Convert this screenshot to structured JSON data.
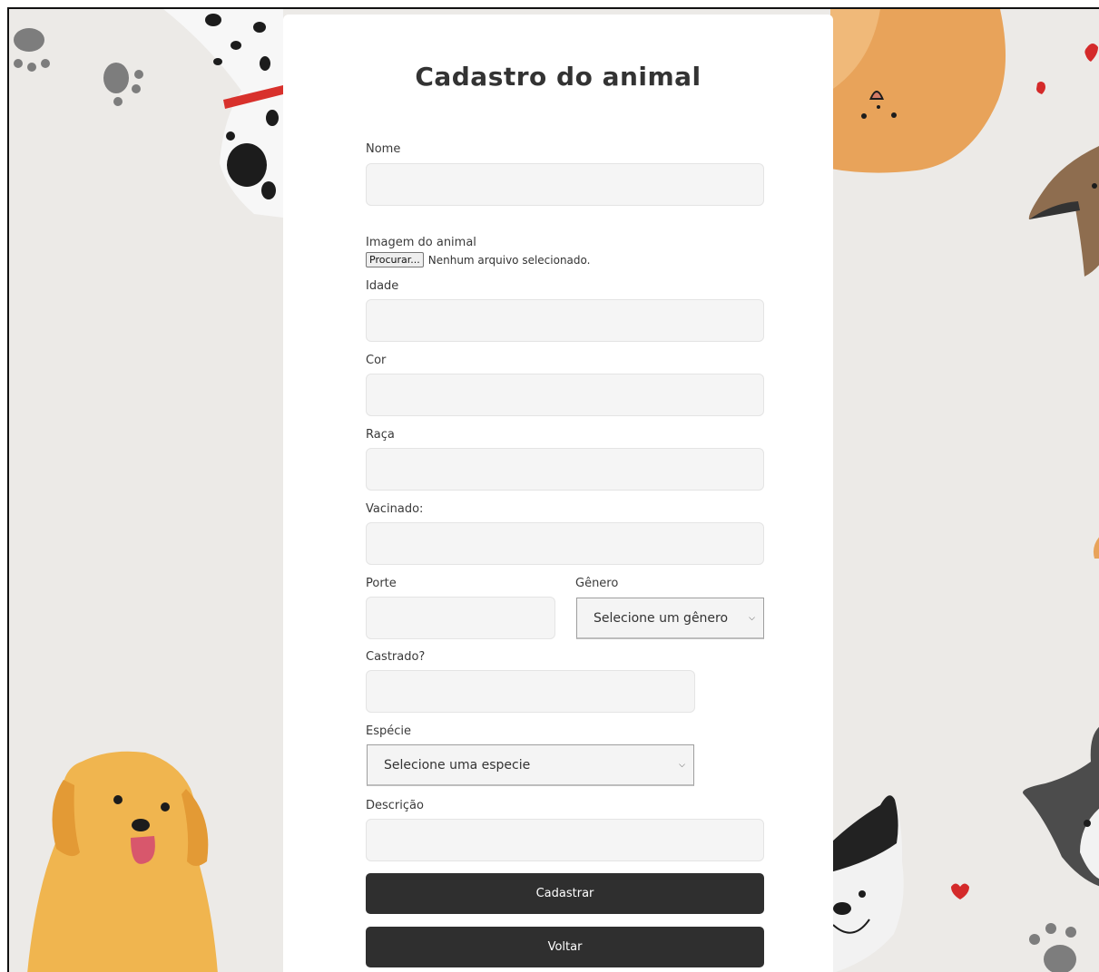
{
  "form": {
    "title": "Cadastro do animal",
    "nome_label": "Nome",
    "imagem_label": "Imagem do animal",
    "file_button": "Procurar...",
    "file_status": "Nenhum arquivo selecionado.",
    "idade_label": "Idade",
    "cor_label": "Cor",
    "raca_label": "Raça",
    "vacinado_label": "Vacinado:",
    "porte_label": "Porte",
    "genero_label": "Gênero",
    "genero_selected": "Selecione um gênero",
    "castrado_label": "Castrado?",
    "especie_label": "Espécie",
    "especie_selected": "Selecione uma especie",
    "descricao_label": "Descrição",
    "cadastrar_button": "Cadastrar",
    "voltar_button": "Voltar"
  },
  "colors": {
    "background": "#eceae7",
    "card": "#ffffff",
    "input": "#f5f5f5",
    "button": "#2f2f2f",
    "heart": "#d42a2a"
  },
  "icons": [
    "paw-print-icon",
    "dog-illustration",
    "cat-illustration",
    "heart-icon",
    "chevron-down-icon"
  ]
}
